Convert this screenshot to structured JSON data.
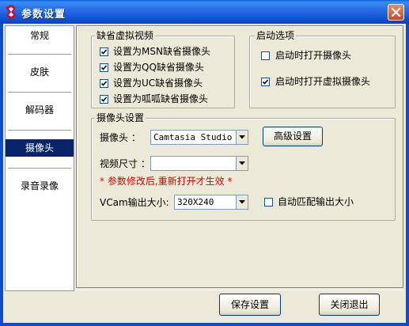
{
  "window": {
    "title": "参数设置",
    "close_icon": "close-icon",
    "app_icon": "app-logo-icon"
  },
  "sidebar": {
    "items": [
      {
        "label": "常规",
        "selected": false
      },
      {
        "label": "皮肤",
        "selected": false
      },
      {
        "label": "解码器",
        "selected": false
      },
      {
        "label": "摄像头",
        "selected": true
      },
      {
        "label": "录音录像",
        "selected": false
      }
    ]
  },
  "default_virtual_camera": {
    "title": "缺省虚拟视频",
    "options": [
      {
        "label": "设置为MSN缺省摄像头",
        "checked": true
      },
      {
        "label": "设置为QQ缺省摄像头",
        "checked": true
      },
      {
        "label": "设置为UC缺省摄像头",
        "checked": true
      },
      {
        "label": "设置为呱呱缺省摄像头",
        "checked": true
      }
    ]
  },
  "startup_options": {
    "title": "启动选项",
    "options": [
      {
        "label": "启动时打开摄像头",
        "checked": false
      },
      {
        "label": "启动时打开虚拟摄像头",
        "checked": true
      }
    ]
  },
  "camera_settings": {
    "title": "摄像头设置",
    "camera_label": "摄像头 ：",
    "camera_value": "Camtasia Studio Vi",
    "advanced_button": "高级设置",
    "video_size_label": "视频尺寸 ：",
    "video_size_value": "",
    "warning": "* 参数修改后,重新打开才生效 *",
    "vcam_size_label": "VCam输出大小:",
    "vcam_size_value": "320X240",
    "auto_match_label": "自动匹配输出大小",
    "auto_match_checked": false
  },
  "footer": {
    "save_button": "保存设置",
    "close_button": "关闭退出"
  },
  "colors": {
    "titlebar": "#0b4fd0",
    "dialog_bg": "#ece9d8",
    "selected_item": "#0a246a",
    "warning": "#e00000"
  }
}
